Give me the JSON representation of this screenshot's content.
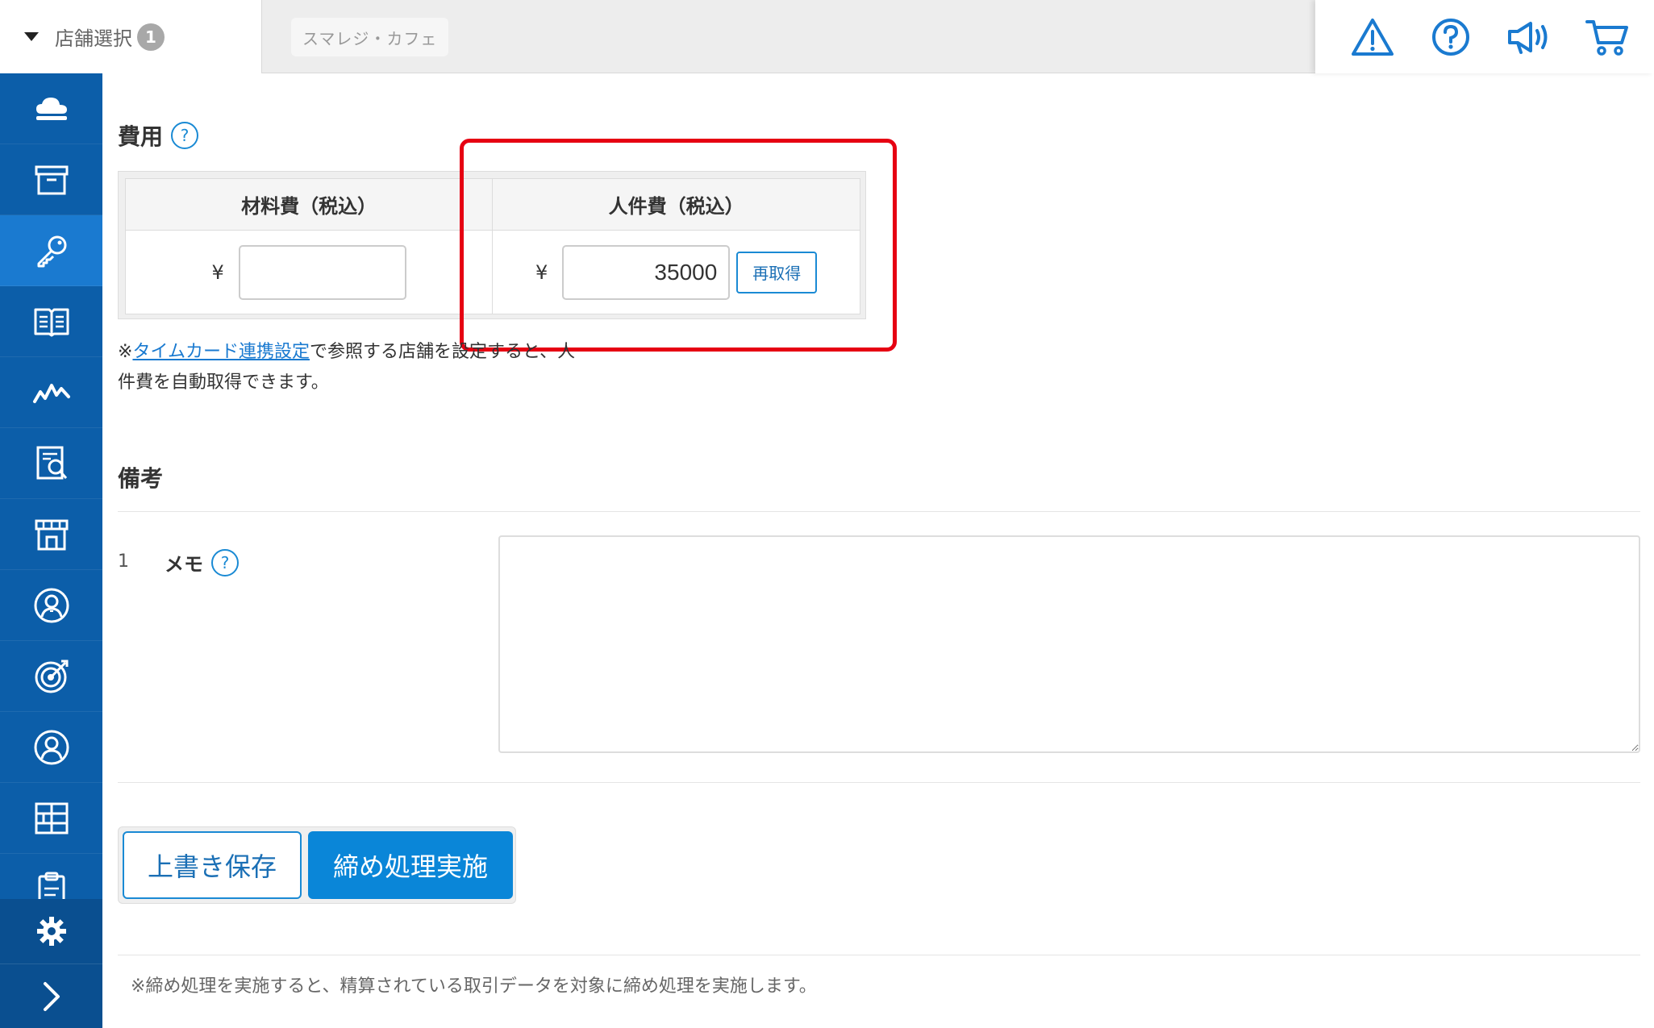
{
  "header": {
    "store_select_label": "店舗選択",
    "store_select_count": "1",
    "store_chip": "スマレジ・カフェ",
    "icons": [
      "warning-icon",
      "help-icon",
      "megaphone-icon",
      "cart-icon"
    ]
  },
  "sidebar": {
    "items": [
      "cloud-icon",
      "archive-icon",
      "key-icon",
      "book-icon",
      "chart-line-icon",
      "report-icon",
      "store-icon",
      "user-badge-icon",
      "target-icon",
      "person-icon",
      "grid-icon",
      "clipboard-icon"
    ],
    "active_index": 2,
    "settings_icon": "gear-icon",
    "expand_icon": "chevron-right-icon"
  },
  "costs": {
    "title": "費用",
    "help": "?",
    "material_header": "材料費（税込）",
    "labor_header": "人件費（税込）",
    "currency": "¥",
    "material_value": "",
    "labor_value": "35000",
    "refetch_label": "再取得",
    "note_prefix": "※",
    "note_link": "タイムカード連携設定",
    "note_rest_line1": "で参照する店舗を設定すると、人",
    "note_line2": "件費を自動取得できます。"
  },
  "remarks": {
    "title": "備考",
    "row_number": "1",
    "memo_label": "メモ",
    "help": "?",
    "memo_value": ""
  },
  "actions": {
    "save_label": "上書き保存",
    "close_label": "締め処理実施"
  },
  "footer_note": "※締め処理を実施すると、精算されている取引データを対象に締め処理を実施します。",
  "colors": {
    "sidebar": "#0c5ea9",
    "sidebar_active": "#1a7ad0",
    "accent": "#0a86d8",
    "highlight": "#e60012"
  }
}
